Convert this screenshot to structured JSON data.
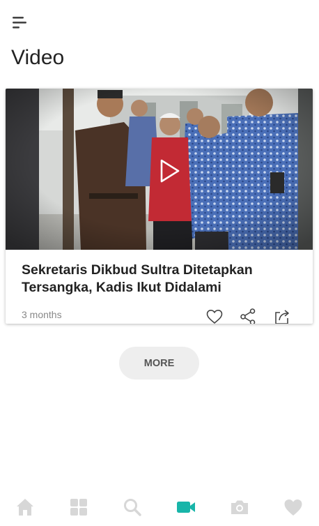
{
  "page": {
    "title": "Video"
  },
  "header": {
    "menu_icon": "menu-icon"
  },
  "video_card": {
    "title": "Sekretaris Dikbud Sultra Ditetapkan Tersangka, Kadis Ikut Didalami",
    "time_ago": "3 months",
    "play_icon": "play-icon",
    "actions": [
      "heart-outline-icon",
      "share-icon",
      "external-share-icon"
    ]
  },
  "more_button": {
    "label": "MORE"
  },
  "bottom_nav": {
    "items": [
      "home",
      "categories",
      "search",
      "video",
      "photo",
      "favorites"
    ],
    "active": "video",
    "colors": {
      "inactive": "#d7d7d7",
      "active": "#18b5a9"
    }
  }
}
